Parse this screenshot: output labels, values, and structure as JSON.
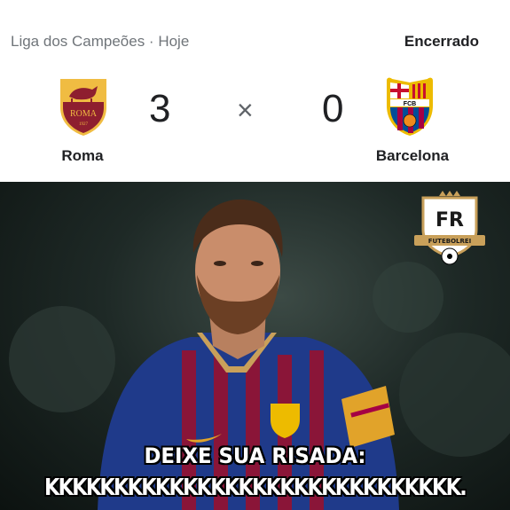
{
  "match": {
    "competition": "Liga dos Campeões · Hoje",
    "status": "Encerrado",
    "separator": "×",
    "home": {
      "name": "Roma",
      "score": "3",
      "crest": "roma-crest-icon",
      "crest_text": "ROMA",
      "crest_year": "1927"
    },
    "away": {
      "name": "Barcelona",
      "score": "0",
      "crest": "barcelona-crest-icon",
      "crest_text": "FCB"
    }
  },
  "meme": {
    "watermark": "FUTEBOLREI",
    "watermark_monogram": "FR",
    "caption_line1": "DEIXE SUA RISADA:",
    "caption_line2": "KKKKKKKKKKKKKKKKKKKKKKKKKKKKKK."
  },
  "colors": {
    "roma_red": "#8e1f2f",
    "roma_gold": "#f0bc42",
    "barca_blue": "#004d98",
    "barca_garnet": "#a50044",
    "barca_gold": "#edbb00"
  }
}
